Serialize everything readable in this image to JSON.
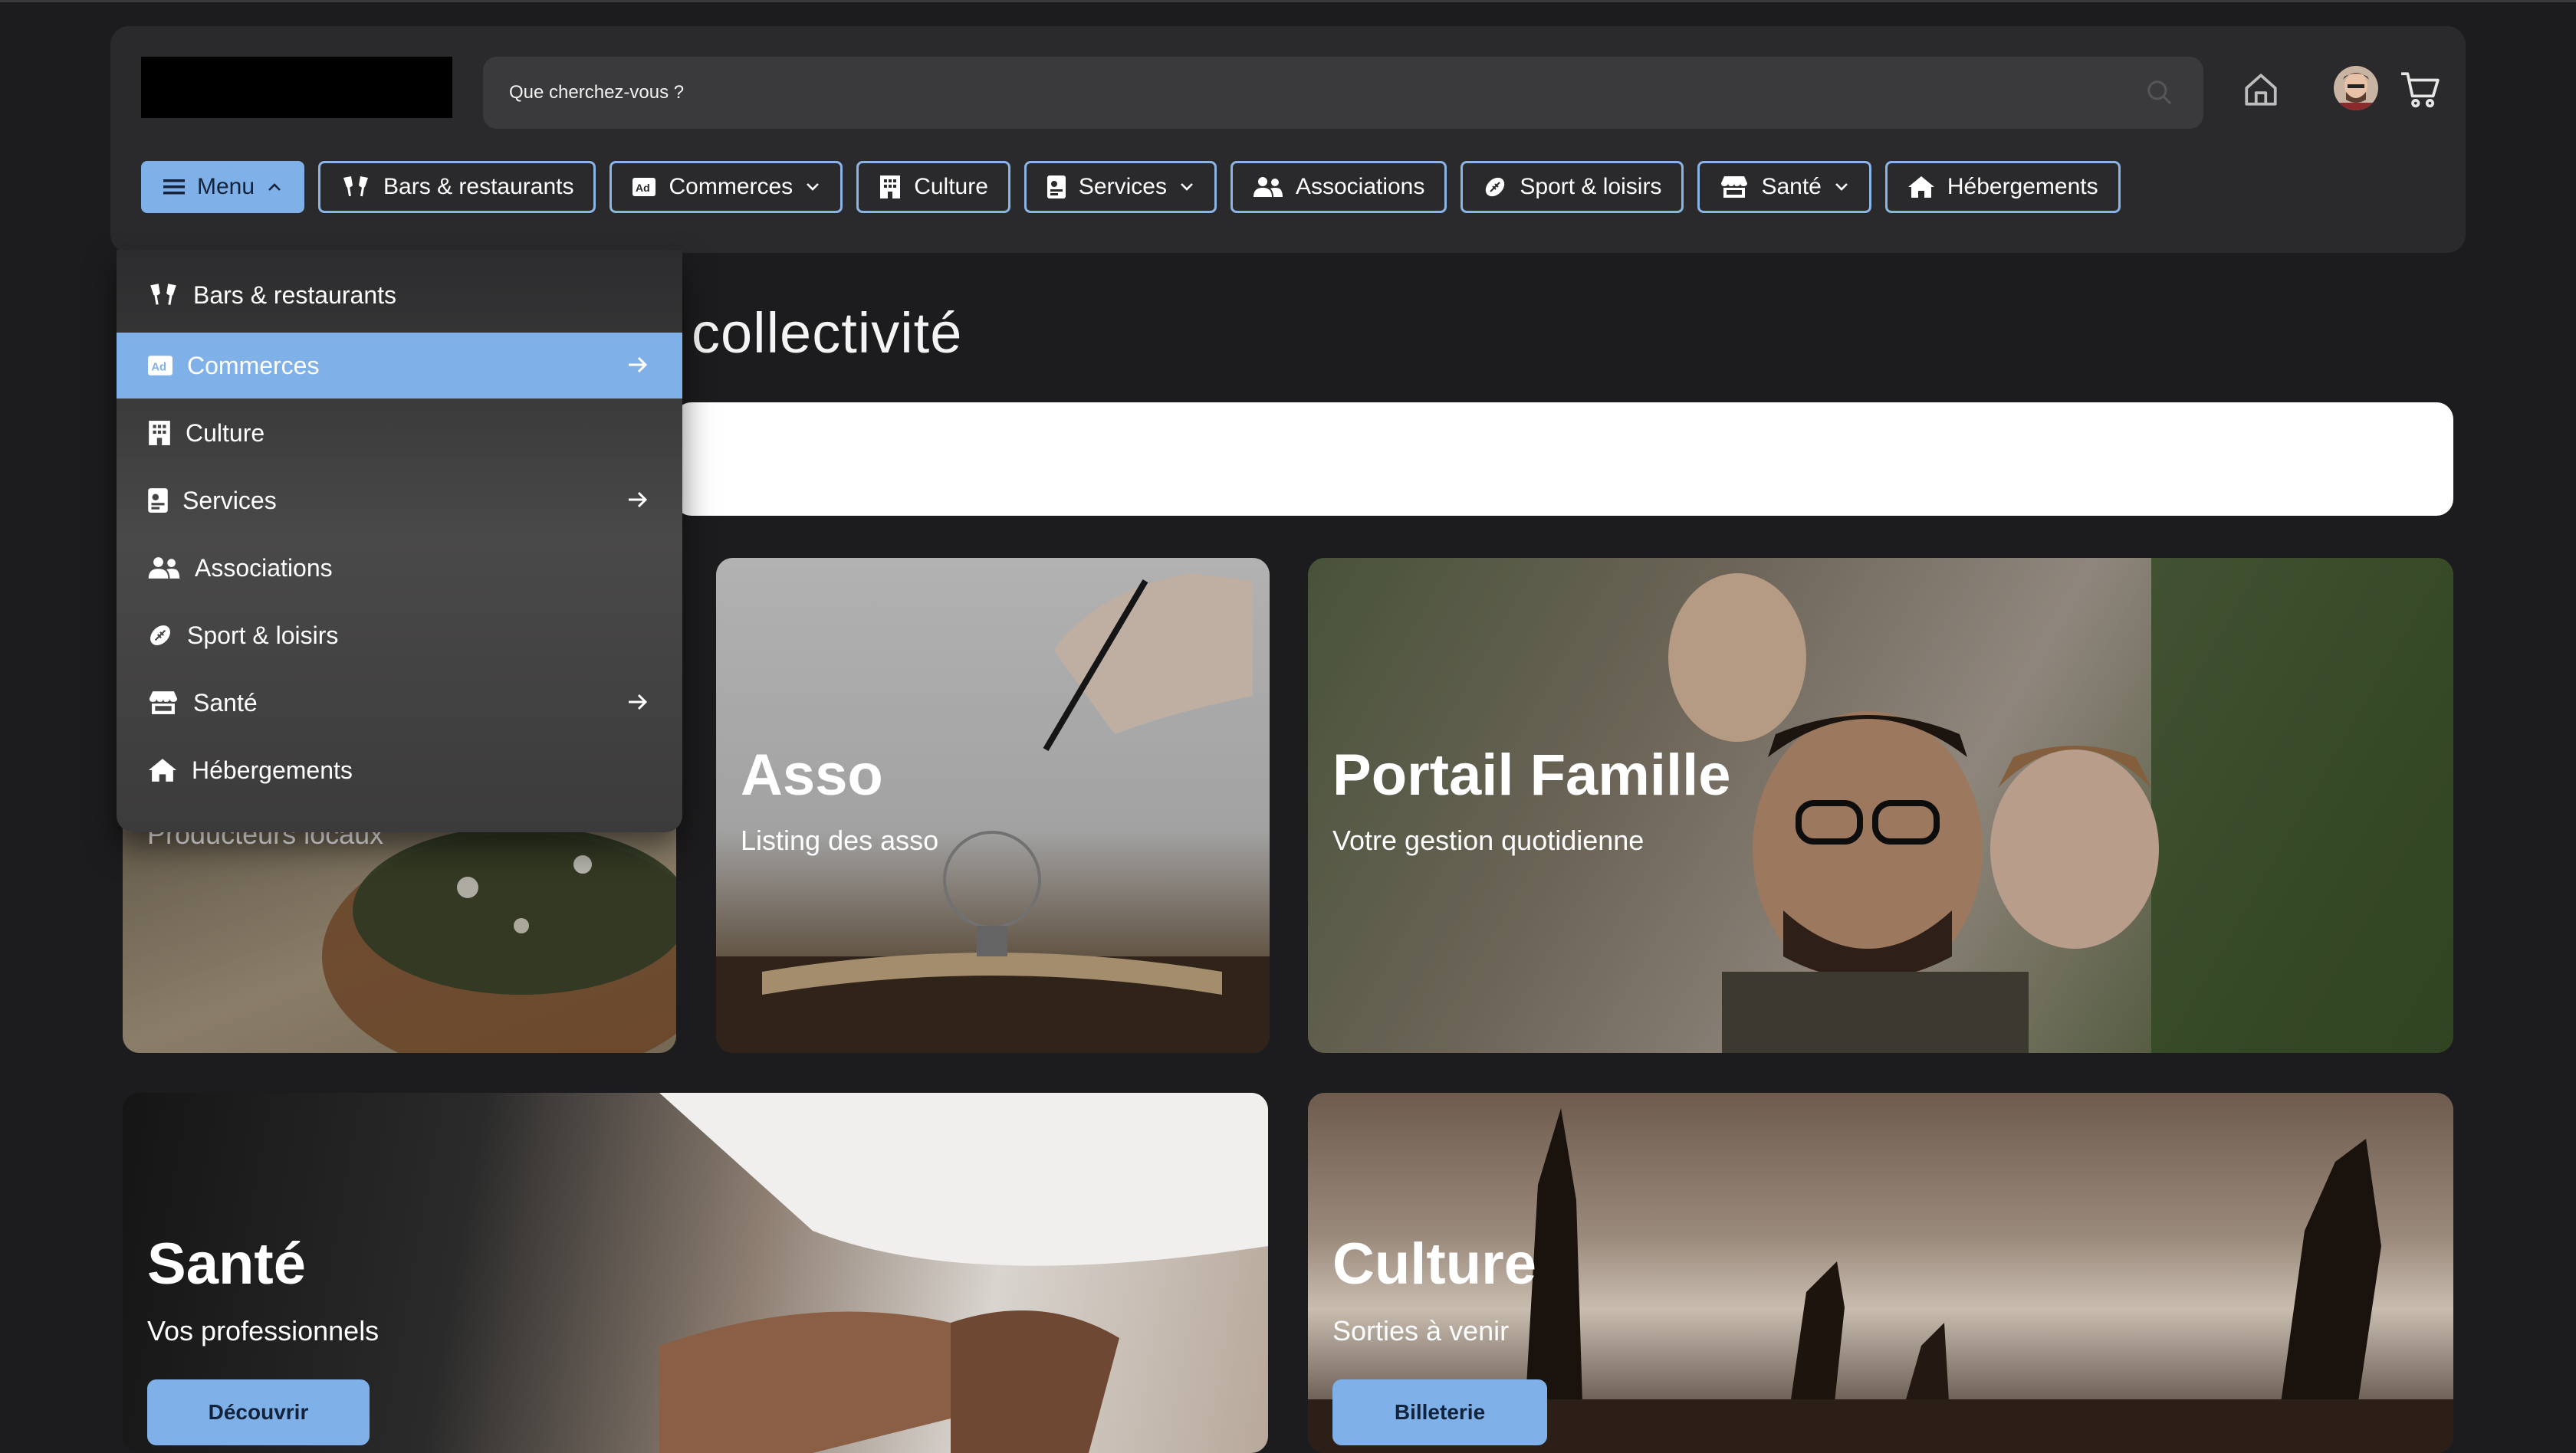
{
  "search": {
    "placeholder": "Que cherchez-vous ?"
  },
  "nav": {
    "menu_label": "Menu",
    "items": [
      {
        "label": "Bars & restaurants",
        "icon": "champagne-glasses-icon",
        "has_chevron": false
      },
      {
        "label": "Commerces",
        "icon": "ad-icon",
        "has_chevron": true
      },
      {
        "label": "Culture",
        "icon": "building-icon",
        "has_chevron": false
      },
      {
        "label": "Services",
        "icon": "id-card-icon",
        "has_chevron": true
      },
      {
        "label": "Associations",
        "icon": "users-icon",
        "has_chevron": false
      },
      {
        "label": "Sport & loisirs",
        "icon": "football-icon",
        "has_chevron": false
      },
      {
        "label": "Santé",
        "icon": "store-icon",
        "has_chevron": true
      },
      {
        "label": "Hébergements",
        "icon": "house-icon",
        "has_chevron": false
      }
    ]
  },
  "dropdown": {
    "items": [
      {
        "label": "Bars & restaurants",
        "icon": "champagne-glasses-icon",
        "has_arrow": false,
        "active": false
      },
      {
        "label": "Commerces",
        "icon": "ad-icon",
        "has_arrow": true,
        "active": true
      },
      {
        "label": "Culture",
        "icon": "building-icon",
        "has_arrow": false,
        "active": false
      },
      {
        "label": "Services",
        "icon": "id-card-icon",
        "has_arrow": true,
        "active": false
      },
      {
        "label": "Associations",
        "icon": "users-icon",
        "has_arrow": false,
        "active": false
      },
      {
        "label": "Sport & loisirs",
        "icon": "football-icon",
        "has_arrow": false,
        "active": false
      },
      {
        "label": "Santé",
        "icon": "store-icon",
        "has_arrow": true,
        "active": false
      },
      {
        "label": "Hébergements",
        "icon": "house-icon",
        "has_arrow": false,
        "active": false
      }
    ]
  },
  "page": {
    "title_fragment": "collectivité"
  },
  "cards": {
    "producteurs": {
      "subtitle": "Producteurs locaux"
    },
    "asso": {
      "title": "Asso",
      "subtitle": "Listing des asso"
    },
    "famille": {
      "title": "Portail Famille",
      "subtitle": "Votre gestion quotidienne"
    },
    "sante": {
      "title": "Santé",
      "subtitle": "Vos professionnels",
      "button": "Découvrir"
    },
    "culture": {
      "title": "Culture",
      "subtitle": "Sorties à venir",
      "button": "Billeterie"
    }
  },
  "colors": {
    "accent": "#7fb1e8",
    "background": "#1c1b1d",
    "header": "#2a292b"
  }
}
